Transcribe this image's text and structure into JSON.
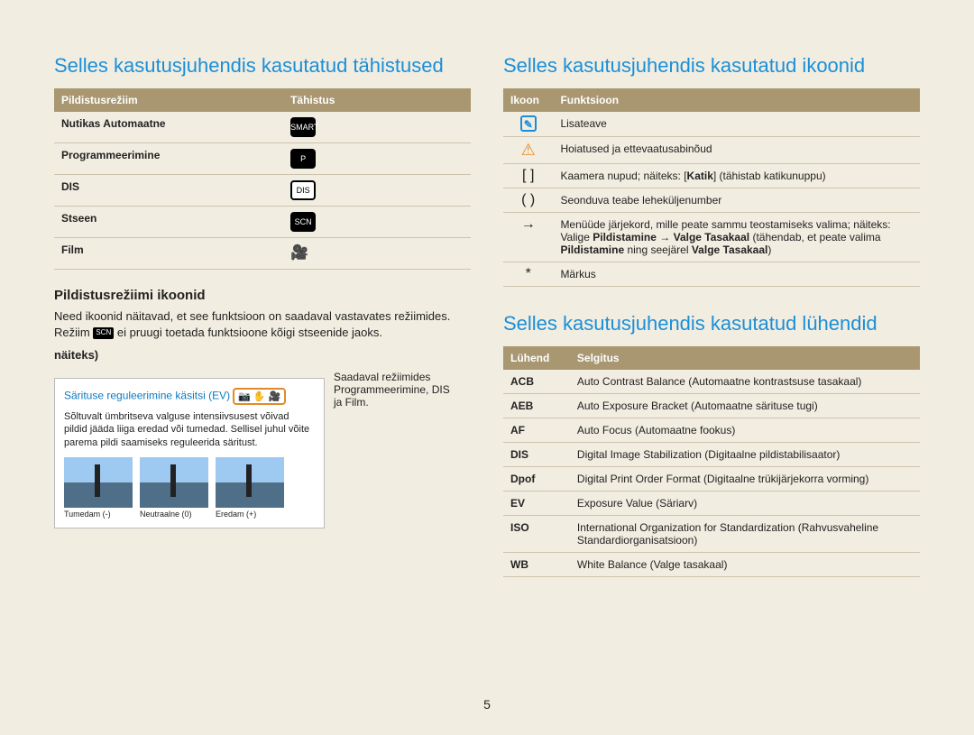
{
  "page_number": "5",
  "left": {
    "heading": "Selles kasutusjuhendis kasutatud tähistused",
    "table_headers": {
      "mode": "Pildistusrežiim",
      "sym": "Tähistus"
    },
    "rows": [
      {
        "mode": "Nutikas Automaatne",
        "sym": "SMART"
      },
      {
        "mode": "Programmeerimine",
        "sym": "P"
      },
      {
        "mode": "DIS",
        "sym": "DIS"
      },
      {
        "mode": "Stseen",
        "sym": "SCN"
      },
      {
        "mode": "Film",
        "sym": "🎥"
      }
    ],
    "sub_heading": "Pildistusrežiimi ikoonid",
    "paragraph": "Need ikoonid näitavad, et see funktsioon on saadaval vastavates režiimides. Režiim ",
    "paragraph_after": " ei pruugi toetada funktsioone kõigi stseenide jaoks.",
    "example_label": "näiteks)",
    "example": {
      "title": "Särituse reguleerimine käsitsi (EV)",
      "tag_icons": "📷 ✋ 🎥",
      "body": "Sõltuvalt ümbritseva valguse intensiivsusest võivad pildid jääda liiga eredad või tumedad. Sellisel juhul võite parema pildi saamiseks reguleerida säritust.",
      "thumbs": [
        {
          "cap": "Tumedam (-)"
        },
        {
          "cap": "Neutraalne (0)"
        },
        {
          "cap": "Eredam (+)"
        }
      ]
    },
    "example_caption": "Saadaval režiimides Programmeerimine, DIS ja Film."
  },
  "right": {
    "heading_icons": "Selles kasutusjuhendis kasutatud ikoonid",
    "icons_headers": {
      "icon": "Ikoon",
      "func": "Funktsioon"
    },
    "icons_rows": [
      {
        "icon": "note",
        "func": "Lisateave"
      },
      {
        "icon": "warn",
        "func": "Hoiatused ja ettevaatusabinõud"
      },
      {
        "icon": "[  ]",
        "func_pre": "Kaamera nupud; näiteks: [",
        "func_bold": "Katik",
        "func_post": "] (tähistab katikunuppu)"
      },
      {
        "icon": "(  )",
        "func": "Seonduva teabe leheküljenumber"
      },
      {
        "icon": "→",
        "func_pre": "Menüüde järjekord, mille peate sammu teostamiseks valima; näiteks: Valige ",
        "func_b1": "Pildistamine",
        "arrow": " → ",
        "func_b2": "Valge Tasakaal",
        "func_mid": " (tähendab, et peate valima ",
        "func_b3": "Pildistamine",
        "func_mid2": " ning seejärel ",
        "func_b4": "Valge Tasakaal",
        "func_end": ")"
      },
      {
        "icon": "*",
        "func": "Märkus"
      }
    ],
    "heading_abbr": "Selles kasutusjuhendis kasutatud lühendid",
    "abbr_headers": {
      "abbr": "Lühend",
      "desc": "Selgitus"
    },
    "abbr_rows": [
      {
        "abbr": "ACB",
        "desc": "Auto Contrast Balance (Automaatne kontrastsuse tasakaal)"
      },
      {
        "abbr": "AEB",
        "desc": "Auto Exposure Bracket (Automaatne särituse tugi)"
      },
      {
        "abbr": "AF",
        "desc": "Auto Focus (Automaatne fookus)"
      },
      {
        "abbr": "DIS",
        "desc": "Digital Image Stabilization (Digitaalne pildistabilisaator)"
      },
      {
        "abbr": "Dpof",
        "desc": "Digital Print Order Format (Digitaalne trükijärjekorra vorming)"
      },
      {
        "abbr": "EV",
        "desc": "Exposure Value (Säriarv)"
      },
      {
        "abbr": "ISO",
        "desc": "International Organization for Standardization (Rahvusvaheline Standardiorganisatsioon)"
      },
      {
        "abbr": "WB",
        "desc": "White Balance (Valge tasakaal)"
      }
    ]
  }
}
